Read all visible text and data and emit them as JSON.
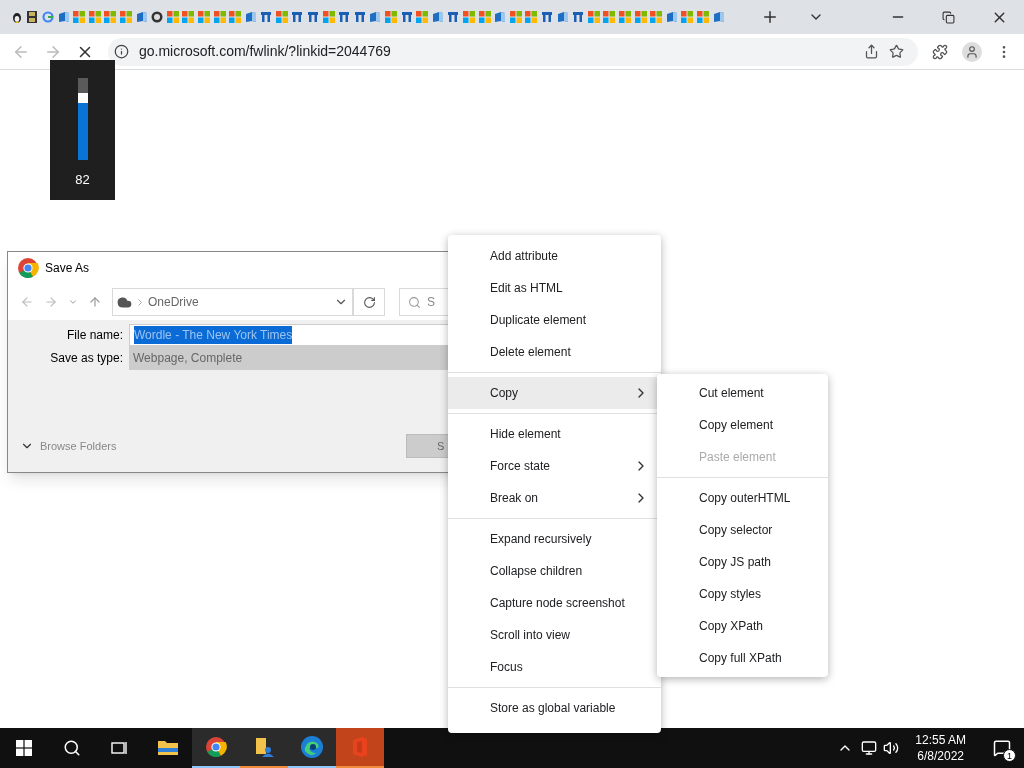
{
  "tabs": [
    {
      "kind": "penguin"
    },
    {
      "kind": "film"
    },
    {
      "kind": "google"
    },
    {
      "kind": "edge"
    },
    {
      "kind": "windows"
    },
    {
      "kind": "windows"
    },
    {
      "kind": "windows"
    },
    {
      "kind": "windows"
    },
    {
      "kind": "edge"
    },
    {
      "kind": "github"
    },
    {
      "kind": "windows"
    },
    {
      "kind": "windows"
    },
    {
      "kind": "windows"
    },
    {
      "kind": "windows"
    },
    {
      "kind": "windows"
    },
    {
      "kind": "edge"
    },
    {
      "kind": "store"
    },
    {
      "kind": "windows"
    },
    {
      "kind": "store"
    },
    {
      "kind": "store"
    },
    {
      "kind": "windows"
    },
    {
      "kind": "store"
    },
    {
      "kind": "store"
    },
    {
      "kind": "edge"
    },
    {
      "kind": "windows"
    },
    {
      "kind": "store"
    },
    {
      "kind": "windows"
    },
    {
      "kind": "edge"
    },
    {
      "kind": "store"
    },
    {
      "kind": "windows"
    },
    {
      "kind": "windows"
    },
    {
      "kind": "edge"
    },
    {
      "kind": "windows"
    },
    {
      "kind": "windows"
    },
    {
      "kind": "store"
    },
    {
      "kind": "edge"
    },
    {
      "kind": "store"
    },
    {
      "kind": "windows"
    },
    {
      "kind": "windows"
    },
    {
      "kind": "windows"
    },
    {
      "kind": "windows"
    },
    {
      "kind": "windows"
    },
    {
      "kind": "edge"
    },
    {
      "kind": "windows"
    },
    {
      "kind": "windows"
    },
    {
      "kind": "edge"
    }
  ],
  "address_bar": {
    "url": "go.microsoft.com/fwlink/?linkid=2044769"
  },
  "volume": {
    "reading": "82"
  },
  "save_dialog": {
    "title": "Save As",
    "location": "OneDrive",
    "search_placeholder": "S",
    "file_name_label": "File name:",
    "file_name": "Wordle - The New York Times",
    "type_label": "Save as type:",
    "type": "Webpage, Complete",
    "browse": "Browse Folders",
    "save_button": "S"
  },
  "context_menu": [
    [
      {
        "label": "Add attribute",
        "submenu": false,
        "selected": false
      },
      {
        "label": "Edit as HTML",
        "submenu": false,
        "selected": false
      },
      {
        "label": "Duplicate element",
        "submenu": false,
        "selected": false
      },
      {
        "label": "Delete element",
        "submenu": false,
        "selected": false
      }
    ],
    [
      {
        "label": "Copy",
        "submenu": true,
        "selected": true
      }
    ],
    [
      {
        "label": "Hide element",
        "submenu": false,
        "selected": false
      },
      {
        "label": "Force state",
        "submenu": true,
        "selected": false
      },
      {
        "label": "Break on",
        "submenu": true,
        "selected": false
      }
    ],
    [
      {
        "label": "Expand recursively",
        "submenu": false,
        "selected": false
      },
      {
        "label": "Collapse children",
        "submenu": false,
        "selected": false
      },
      {
        "label": "Capture node screenshot",
        "submenu": false,
        "selected": false
      },
      {
        "label": "Scroll into view",
        "submenu": false,
        "selected": false
      },
      {
        "label": "Focus",
        "submenu": false,
        "selected": false
      }
    ],
    [
      {
        "label": "Store as global variable",
        "submenu": false,
        "selected": false
      }
    ]
  ],
  "copy_submenu": [
    [
      {
        "label": "Cut element",
        "disabled": false
      },
      {
        "label": "Copy element",
        "disabled": false
      },
      {
        "label": "Paste element",
        "disabled": true
      }
    ],
    [
      {
        "label": "Copy outerHTML",
        "disabled": false
      },
      {
        "label": "Copy selector",
        "disabled": false
      },
      {
        "label": "Copy JS path",
        "disabled": false
      },
      {
        "label": "Copy styles",
        "disabled": false
      },
      {
        "label": "Copy XPath",
        "disabled": false
      },
      {
        "label": "Copy full XPath",
        "disabled": false
      }
    ]
  ],
  "taskbar": {
    "apps": [
      {
        "kind": "explorer",
        "open": false
      },
      {
        "kind": "chrome",
        "open": true
      },
      {
        "kind": "files",
        "open": true
      },
      {
        "kind": "edge",
        "open": true
      },
      {
        "kind": "office",
        "open": true
      }
    ],
    "time": "12:55 AM",
    "date": "6/8/2022",
    "notifications": "1"
  }
}
